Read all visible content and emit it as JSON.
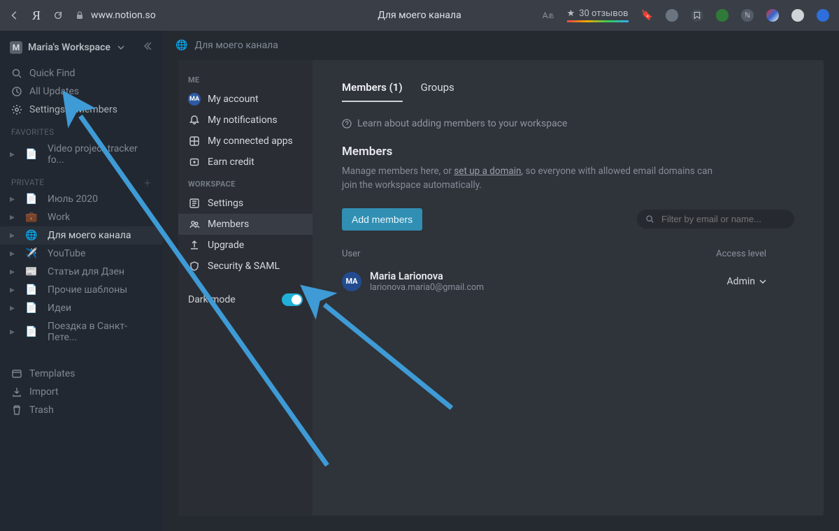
{
  "browser": {
    "url": "www.notion.so",
    "page_title": "Для моего канала",
    "reviews": "30 отзывов"
  },
  "sidebar": {
    "workspace": "Maria's Workspace",
    "util": {
      "find": "Quick Find",
      "updates": "All Updates",
      "settings": "Settings & Members"
    },
    "favorites_label": "FAVORITES",
    "favorites": [
      {
        "label": "Video project tracker fo..."
      }
    ],
    "private_label": "PRIVATE",
    "private": [
      {
        "icon": "📄",
        "label": "Июль 2020"
      },
      {
        "icon": "💼",
        "label": "Work"
      },
      {
        "icon": "🌐",
        "label": "Для моего канала",
        "active": true
      },
      {
        "icon": "✈️",
        "label": "YouTube"
      },
      {
        "icon": "📰",
        "label": "Статьи для Дзен"
      },
      {
        "icon": "📄",
        "label": "Прочие шаблоны"
      },
      {
        "icon": "📄",
        "label": "Идеи"
      },
      {
        "icon": "📄",
        "label": "Поездка в Санкт-Пете..."
      }
    ],
    "bottom": {
      "templates": "Templates",
      "import": "Import",
      "trash": "Trash"
    }
  },
  "breadcrumb": {
    "icon_label": "globe",
    "title": "Для моего канала"
  },
  "settings": {
    "me_label": "ME",
    "me": [
      {
        "key": "account",
        "label": "My account"
      },
      {
        "key": "notifications",
        "label": "My notifications"
      },
      {
        "key": "apps",
        "label": "My connected apps"
      },
      {
        "key": "credit",
        "label": "Earn credit"
      }
    ],
    "ws_label": "WORKSPACE",
    "ws": [
      {
        "key": "settings",
        "label": "Settings"
      },
      {
        "key": "members",
        "label": "Members",
        "active": true
      },
      {
        "key": "upgrade",
        "label": "Upgrade"
      },
      {
        "key": "security",
        "label": "Security & SAML"
      }
    ],
    "dark_mode_label": "Dark mode"
  },
  "members_panel": {
    "tab_members": "Members (1)",
    "tab_groups": "Groups",
    "learn": "Learn about adding members to your workspace",
    "heading": "Members",
    "desc_pre": "Manage members here, or ",
    "desc_link": "set up a domain",
    "desc_post": ", so everyone with allowed email domains can join the workspace automatically.",
    "add_btn": "Add members",
    "filter_placeholder": "Filter by email or name...",
    "col_user": "User",
    "col_access": "Access level",
    "member": {
      "initials": "MA",
      "name": "Maria Larionova",
      "email": "larionova.maria0@gmail.com",
      "access": "Admin"
    }
  }
}
